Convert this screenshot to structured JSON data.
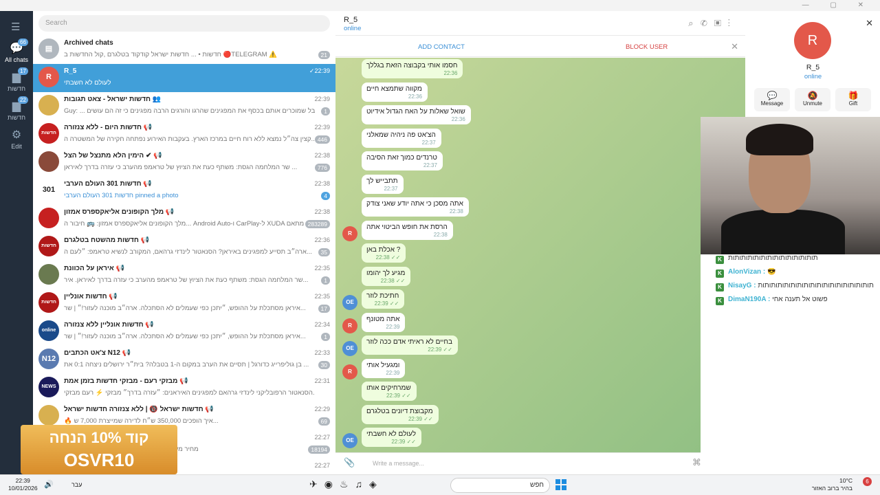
{
  "sidebar": {
    "folders": [
      {
        "label": "All chats",
        "badge": "66"
      },
      {
        "label": "חדשות",
        "badge": "17"
      },
      {
        "label": "חדשות",
        "badge": "22"
      },
      {
        "label": "Edit",
        "badge": ""
      }
    ]
  },
  "chatlist": {
    "search_placeholder": "Search",
    "rows": [
      {
        "name": "Archived chats",
        "msg": "חדשות • ... חדשות ישראל קודקוד בטלגרם ,קול החדשות ב 🔴TELEGRAM ⚠️",
        "time": "",
        "badge": "21",
        "av": "▤",
        "color": "#b0b7be",
        "blue": false
      },
      {
        "name": "R_5",
        "msg": "לעולם לא חשבתי",
        "time": "✓22:39",
        "badge": "",
        "av": "R",
        "color": "#e3584a",
        "blue": false
      },
      {
        "name": "חדשות ישראל - צאט תגובות 👥",
        "msg": "Guy: ... חבל שמוכרים אותם בכסף את המפגינים שהרגו והורגים הרבה מפגינים כי זה הם עושים",
        "time": "22:39",
        "badge": "1",
        "av": "",
        "color": "#d8b050",
        "blue": false
      },
      {
        "name": "חדשות היום - ללא צנזורה 📢",
        "msg": "קצין צה״ל נמצא ללא רוח חיים במרכז הארץ. בעקבות האירוע נפתחה חקירה של המשטרה ה...",
        "time": "22:39",
        "badge": "446",
        "av": "חדשות היום",
        "color": "#c62020",
        "blue": false
      },
      {
        "name": "הימין הלא מתנצל של הצל ✔ 📢",
        "msg": "שר המלחמה הגסת: משתף כעת את הציוץ של טראמפ מהערב כי עזרה בדרך לאיראן ...",
        "time": "22:38",
        "badge": "776",
        "av": "",
        "color": "#8a4a3a",
        "blue": false
      },
      {
        "name": "חדשות 301 העולם הערבי 📢",
        "msg": "חדשות 301 העולם הערבי pinned a photo",
        "time": "22:38",
        "badge": "4",
        "av": "301",
        "color": "#fff",
        "blue": true
      },
      {
        "name": "מלך הקופונים אליאקספרס אמזון 📢",
        "msg": "מלך הקופונים אליאקספרס אמזון: 🚌 חיבור ה... Android Auto-ו CarPlay-ל XUDA מתאם",
        "time": "22:38",
        "badge": "283289",
        "av": "",
        "color": "#c62020",
        "blue": false
      },
      {
        "name": "חדשות מהשטח בטלגרם 📢",
        "msg": "ארה״ב תסייע למפגינים באיראן? הסנאטור לינדזי גרהאם, המקורב לנשיא טראמפ: ״לעם ה...",
        "time": "22:36",
        "badge": "35",
        "av": "חדשות",
        "color": "#b01818",
        "blue": false
      },
      {
        "name": "איראן על הכוונת 📢",
        "msg": "שר המלחמה הגסת: משתף כעת את הציוץ של טראמפ מהערב כי עזרה בדרך לאיראן. איר...",
        "time": "22:35",
        "badge": "1",
        "av": "",
        "color": "#6a7a50",
        "blue": false
      },
      {
        "name": "חדשות אונליין 📢",
        "msg": "איראן מסתכלת על ההופש, ״יתכן כפי שעמלים לא הסתכלה. ארה״ב מוכנה לעזור!״ | שר...",
        "time": "22:35",
        "badge": "17",
        "av": "חדשות",
        "color": "#b01818",
        "blue": false
      },
      {
        "name": "חדשות אונליין ללא צנזורה 📢",
        "msg": "איראן מסתכלת על ההופש, ״יתכן כפי שעמלים לא הסתכלה. ארה״ב מוכנה לעזור!״ | שר...",
        "time": "22:34",
        "badge": "1",
        "av": "online",
        "color": "#1a4a8a",
        "blue": false
      },
      {
        "name": "צ'אט הכתבים N12 📢",
        "msg": "בן גוליפרייג כדורגל | תסיים את הערב במקום ה-1 בטבלה? בית״ר ירושלים ניצחה 0:1 את ...",
        "time": "22:33",
        "badge": "30",
        "av": "N12",
        "color": "#5a7ab0",
        "blue": false
      },
      {
        "name": "מבזקי רעם - מבזקי חדשות בזמן אמת 📢",
        "msg": "הסנאטור הרפובליקני לינדזי גרהאם למפגינים האיראנים: ״עזרה בדרך״ מבזקי ⚡ רעם מבזקי...",
        "time": "22:31",
        "badge": "",
        "av": "NEWS",
        "color": "#1a1a5a",
        "blue": false
      },
      {
        "name": "חדשות ישראל 🔞 | ללא צנזורה חדשות ישראל 📢",
        "msg": "🔥 איך הופכים 350,000 ש״ח לדירה שמייצרת 7,000 ש...",
        "time": "22:29",
        "badge": "69",
        "av": "",
        "color": "#d8b050",
        "blue": false
      },
      {
        "name": "",
        "msg": "🍪 מחיר מעולה ✌️ רק 84 שקל 🛍 - עיינת דיגיטל",
        "time": "22:27",
        "badge": "18194",
        "av": "",
        "color": "#d8b050",
        "blue": false
      },
      {
        "name": "",
        "msg": "",
        "time": "22:27",
        "badge": "",
        "av": "",
        "color": "#d8b050",
        "blue": false
      }
    ]
  },
  "chat": {
    "name": "R_5",
    "status": "online",
    "add_contact": "ADD CONTACT",
    "block_user": "BLOCK USER",
    "composer_placeholder": "Write a message...",
    "messages": [
      {
        "text": "חסמו אותי בקבוצה הזאת בגללך",
        "time": "22:36",
        "out": true,
        "av": ""
      },
      {
        "text": "מקווה שתמצא חיים",
        "time": "22:36",
        "out": false,
        "av": ""
      },
      {
        "text": "שואל שאלות על האח הגדול אידיוט",
        "time": "22:36",
        "out": false,
        "av": ""
      },
      {
        "text": "הצ'אט פה ניהיה שמאלני",
        "time": "22:37",
        "out": false,
        "av": ""
      },
      {
        "text": "טרנדים כמוך זאת הסיבה",
        "time": "22:37",
        "out": false,
        "av": ""
      },
      {
        "text": "תתבייש לך",
        "time": "22:37",
        "out": false,
        "av": ""
      },
      {
        "text": "אתה מסכן כי אתה יודע שאני צודק",
        "time": "22:38",
        "out": false,
        "av": ""
      },
      {
        "text": "הרסת את חופש הביטוי אתה",
        "time": "22:38",
        "out": false,
        "av": "R"
      },
      {
        "text": "אכלת באן ?",
        "time": "22:38 ✓✓",
        "out": true,
        "av": ""
      },
      {
        "text": "מגיע לך יהומו",
        "time": "22:38 ✓✓",
        "out": true,
        "av": ""
      },
      {
        "text": "חתיכת לוזר",
        "time": "22:39 ✓✓",
        "out": true,
        "av": "OE"
      },
      {
        "text": "אתה מטונף",
        "time": "22:39",
        "out": false,
        "av": "R"
      },
      {
        "text": "בחיים לא ראיתי אדם ככה לוזר",
        "time": "22:39 ✓✓",
        "out": true,
        "av": "OE"
      },
      {
        "text": "ומגעיל אותי",
        "time": "22:39",
        "out": false,
        "av": "R"
      },
      {
        "text": "שמרחיקים אותו",
        "time": "22:39 ✓✓",
        "out": true,
        "av": ""
      },
      {
        "text": "מקבוצת דיונים בטלגרם",
        "time": "22:39 ✓✓",
        "out": true,
        "av": ""
      },
      {
        "text": "לעולם לא חשבתי",
        "time": "22:39 ✓✓",
        "out": true,
        "av": "OE"
      }
    ]
  },
  "profile": {
    "initial": "R",
    "name": "R_5",
    "status": "online",
    "btn_message": "Message",
    "btn_unmute": "Unmute",
    "btn_gift": "Gift"
  },
  "stream_chat": [
    {
      "user": "",
      "msg": "תותותותותותותותותותותותותות"
    },
    {
      "user": "AlonVizan :",
      "msg": "😎"
    },
    {
      "user": "NisayG :",
      "msg": "תותותותותותותותותותותותותותותותותות"
    },
    {
      "user": "DimaN190A :",
      "msg": "פשוט אל תענה אחי"
    }
  ],
  "promo": {
    "line1": "קוד 10% הנחה",
    "line2": "OSVR10"
  },
  "taskbar": {
    "time": "22:39",
    "date": "10/01/2026",
    "lang": "עבר",
    "search": "חפש",
    "weather_temp": "10°C",
    "weather_desc": "בהיר ברוב האזור",
    "notif": "6"
  }
}
